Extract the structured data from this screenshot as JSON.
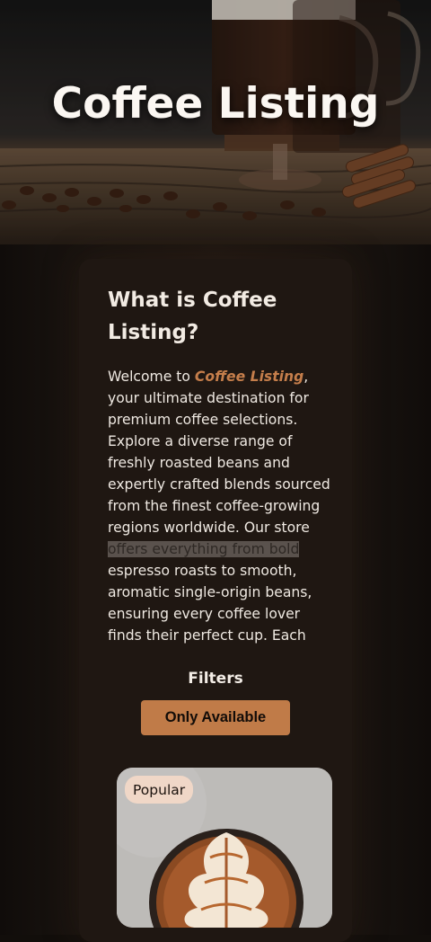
{
  "hero": {
    "title": "Coffee Listing"
  },
  "about": {
    "title": "What is Coffee Listing?",
    "text_before": "Welcome to ",
    "brand": "Coffee Listing",
    "text_middle": ", your ultimate destination for premium coffee selections. Explore a diverse range of freshly roasted beans and expertly crafted blends sourced from the finest coffee-growing regions worldwide. Our store",
    "highlighted": " offers everything from bold",
    "text_after": " espresso roasts to smooth, aromatic single-origin beans, ensuring every coffee lover finds their perfect cup. Each",
    "brand_color": "#c57e4b"
  },
  "filters": {
    "title": "Filters",
    "only_available_label": "Only Available",
    "button_color": "#c07b48"
  },
  "products": [
    {
      "badge": "Popular",
      "badge_color": "#f0d7c7",
      "image_icon": "latte-art-image"
    }
  ],
  "colors": {
    "background": "#120e0b",
    "card": "#1f1712"
  }
}
